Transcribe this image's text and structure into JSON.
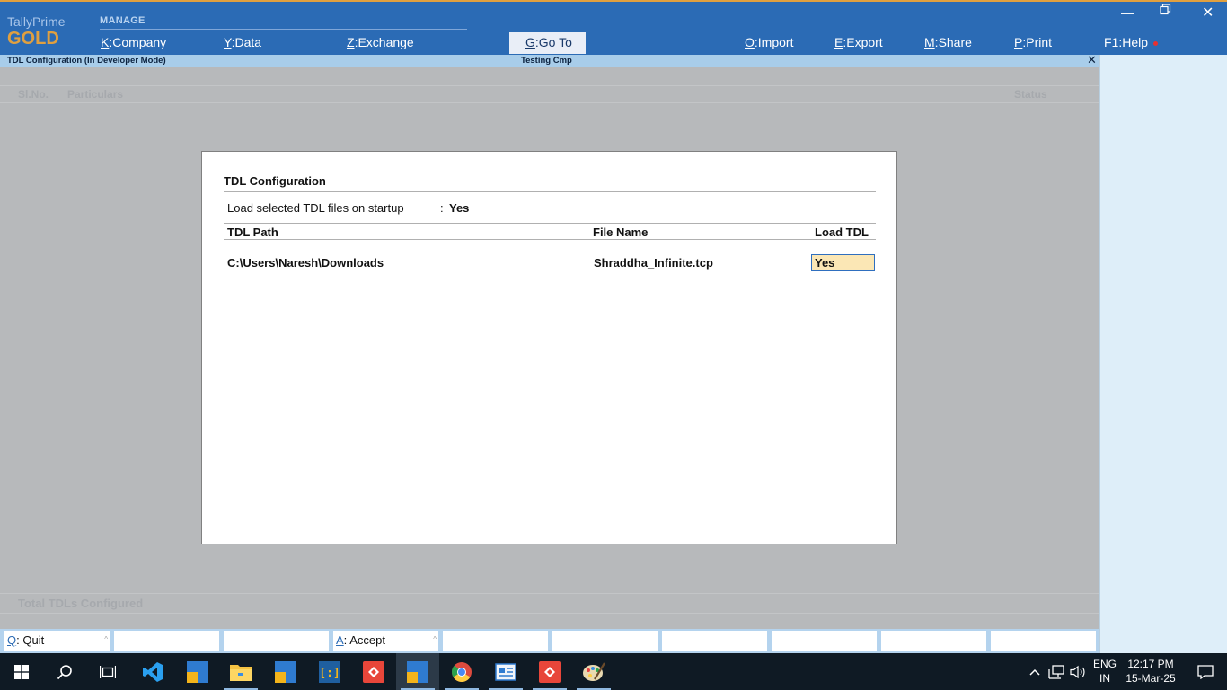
{
  "header": {
    "brand_name": "TallyPrime",
    "brand_edition": "GOLD",
    "manage_label": "MANAGE",
    "menu": [
      {
        "key": "K",
        "label": "Company"
      },
      {
        "key": "Y",
        "label": "Data"
      },
      {
        "key": "Z",
        "label": "Exchange"
      }
    ],
    "goto": {
      "key": "G",
      "label": "Go To"
    },
    "right_menu": [
      {
        "key": "O",
        "label": "Import"
      },
      {
        "key": "E",
        "label": "Export"
      },
      {
        "key": "M",
        "label": "Share"
      },
      {
        "key": "P",
        "label": "Print"
      },
      {
        "key": "F1",
        "label": "Help"
      }
    ]
  },
  "titlebar": {
    "screen_title": "TDL Configuration (In Developer Mode)",
    "company": "Testing Cmp"
  },
  "background_report": {
    "columns": [
      "Sl.No.",
      "Particulars",
      "Status"
    ],
    "footer_label": "Total TDLs Configured"
  },
  "dialog": {
    "title": "TDL Configuration",
    "load_on_startup_label": "Load selected TDL files on startup",
    "load_on_startup_value": "Yes",
    "columns": {
      "path": "TDL Path",
      "file": "File Name",
      "load": "Load TDL"
    },
    "rows": [
      {
        "path": "C:\\Users\\Naresh\\Downloads",
        "file": "Shraddha_Infinite.tcp",
        "load": "Yes"
      }
    ]
  },
  "buttons": [
    {
      "key": "Q",
      "label": "Quit"
    },
    {
      "key": "A",
      "label": "Accept"
    }
  ],
  "taskbar": {
    "language": "ENG",
    "region": "IN",
    "time": "12:17 PM",
    "date": "15-Mar-25"
  },
  "colors": {
    "header_bg": "#2b6bb5",
    "brand_gold": "#e0a040",
    "title_strip": "#a8cdea",
    "main_bg": "#b7b9bb",
    "active_field": "#fbe7b5"
  }
}
